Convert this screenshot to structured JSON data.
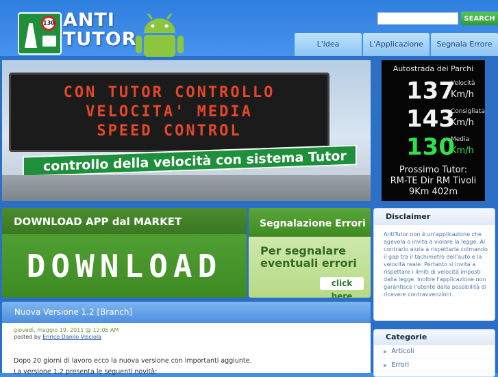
{
  "colors": {
    "brand_blue": "#3f8ee8",
    "accent_green": "#2f9a32",
    "tab_bg": "#8ec6f3"
  },
  "logo": {
    "line1": "ANTI",
    "line2": "TUTOR",
    "sign_limit": "130"
  },
  "search": {
    "placeholder": "",
    "button": "SEARCH"
  },
  "nav": {
    "tabs": [
      {
        "label": "L'idea"
      },
      {
        "label": "L'Applicazione"
      },
      {
        "label": "Segnala Errore"
      }
    ]
  },
  "slide": {
    "vms_lines": [
      "CON TUTOR CONTROLLO",
      "VELOCITA' MEDIA",
      "SPEED CONTROL"
    ],
    "board": "controllo della velocità con sistema Tutor"
  },
  "tutor_panel": {
    "title": "Autostrada dei Parchi",
    "rows": [
      {
        "value": "137",
        "label": "Velocità",
        "unit": "Km/h",
        "color": "#f2f2f2"
      },
      {
        "value": "143",
        "label": "Consigliata",
        "unit": "Km/h",
        "color": "#f2f2f2"
      },
      {
        "value": "130",
        "label": "Media",
        "unit": "Km/h",
        "color": "#2fe04a"
      }
    ],
    "next_label": "Prossimo Tutor:",
    "next_name": "RM-TE Dir RM Tivoli",
    "next_distance": "9Km 402m"
  },
  "download_banner": {
    "header": "DOWNLOAD APP dal MARKET",
    "big": "DOWNLOAD"
  },
  "errors_banner": {
    "header": "Segnalazione Errori",
    "line1": "Per segnalare",
    "line2": "eventuali errori",
    "button": "click here"
  },
  "post": {
    "title": "Nuova Versione 1.2 [Branch]",
    "date": "giovedì, maggio 19, 2011 @ 12:05 AM",
    "posted_by": "posted by",
    "author": "Enrico Danilo Visciola",
    "p1": "Dopo 20 giorni di lavoro ecco la nuova versione con importanti aggiunte.",
    "p2": "La versione 1.2 presenta le seguenti novità:"
  },
  "sidebar": {
    "disclaimer": {
      "title": "Disclaimer",
      "text": "AntiTutor non è un'applicazione che agevola o invita a violare la legge. Al contrario aiuta a rispettarla colmando il gap tra il tachimetro dell'auto e la velocità reale. Pertanto si invita a rispettare i limiti di velocità imposti dalla legge. Inoltre l'applicazione non garantisce l'utente dalla possibilità di ricevere contravvenzioni."
    },
    "categories": {
      "title": "Categorie",
      "items": [
        {
          "label": "Articoli"
        },
        {
          "label": "Errori"
        }
      ]
    }
  }
}
